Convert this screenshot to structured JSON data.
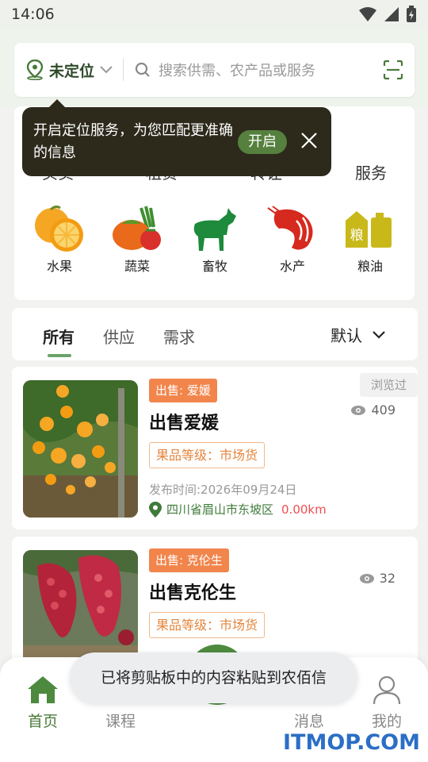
{
  "status": {
    "time": "14:06"
  },
  "search": {
    "location_label": "未定位",
    "placeholder": "搜索供需、农产品或服务"
  },
  "categories": {
    "tabs": [
      "买卖",
      "租赁",
      "转让",
      "服务"
    ],
    "items": [
      {
        "label": "水果",
        "icon": "fruit-icon"
      },
      {
        "label": "蔬菜",
        "icon": "vegetable-icon"
      },
      {
        "label": "畜牧",
        "icon": "livestock-icon"
      },
      {
        "label": "水产",
        "icon": "aquatic-icon"
      },
      {
        "label": "粮油",
        "icon": "grain-oil-icon",
        "glyph": "粮"
      }
    ]
  },
  "tooltip": {
    "text": "开启定位服务，为您匹配更准确的信息",
    "button": "开启"
  },
  "filter": {
    "tabs": [
      "所有",
      "供应",
      "需求"
    ],
    "active": "所有",
    "sort_label": "默认"
  },
  "posts": [
    {
      "tag": "出售: 爱媛",
      "title": "出售爱媛",
      "grade": "果品等级：市场货",
      "views": "409",
      "viewed_badge": "浏览过",
      "date": "发布时间:2026年09月24日",
      "location": "四川省眉山市东坡区",
      "distance": "0.00km"
    },
    {
      "tag": "出售: 克伦生",
      "title": "出售克伦生",
      "grade": "果品等级：市场货",
      "views": "32"
    }
  ],
  "toast": "已将剪贴板中的内容粘贴到农佰信",
  "nav": {
    "items": [
      "首页",
      "课程",
      "消息",
      "我的"
    ],
    "active": "首页"
  },
  "watermark": "ITMOP.COM",
  "colors": {
    "brand_green": "#4d8a3f",
    "tag_orange": "#f2854c",
    "distance_red": "#f04e4e",
    "tooltip_bg": "#2d2a1c"
  }
}
